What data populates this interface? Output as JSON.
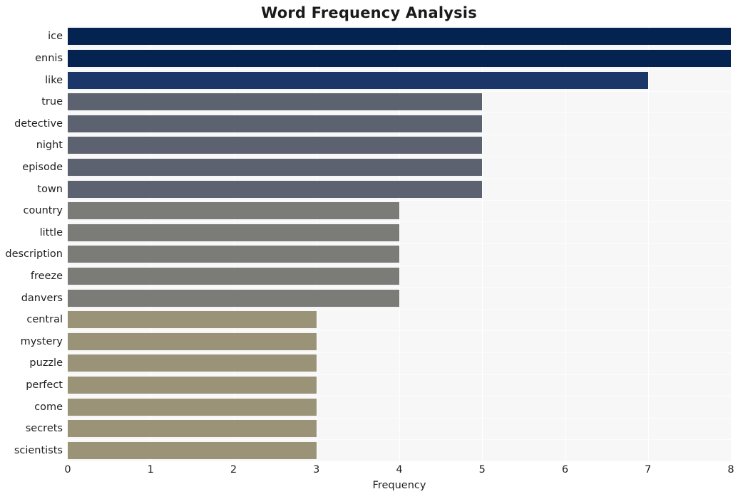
{
  "chart_data": {
    "type": "bar",
    "orientation": "horizontal",
    "title": "Word Frequency Analysis",
    "xlabel": "Frequency",
    "ylabel": "",
    "xlim": [
      0,
      8
    ],
    "xticks": [
      "0",
      "1",
      "2",
      "3",
      "4",
      "5",
      "6",
      "7",
      "8"
    ],
    "grid": true,
    "legend": null,
    "categories": [
      "ice",
      "ennis",
      "like",
      "true",
      "detective",
      "night",
      "episode",
      "town",
      "country",
      "little",
      "description",
      "freeze",
      "danvers",
      "central",
      "mystery",
      "puzzle",
      "perfect",
      "come",
      "secrets",
      "scientists"
    ],
    "values": [
      8,
      8,
      7,
      5,
      5,
      5,
      5,
      5,
      4,
      4,
      4,
      4,
      4,
      3,
      3,
      3,
      3,
      3,
      3,
      3
    ],
    "bar_colors": [
      "#042351",
      "#042351",
      "#1b3668",
      "#5d6270",
      "#5d6270",
      "#5d6270",
      "#5d6270",
      "#5d6270",
      "#7b7b78",
      "#7b7b78",
      "#7b7b78",
      "#7b7b78",
      "#7b7b78",
      "#9a9378",
      "#9a9378",
      "#9a9378",
      "#9a9378",
      "#9a9378",
      "#9a9378",
      "#9a9378"
    ],
    "palette": {
      "darkest_navy": "#042351",
      "navy": "#1b3668",
      "slate": "#5d6270",
      "gray": "#7b7b78",
      "khaki": "#9a9378",
      "plot_background": "#f7f7f7",
      "figure_background": "#ffffff",
      "gridline": "#ffffff"
    }
  }
}
